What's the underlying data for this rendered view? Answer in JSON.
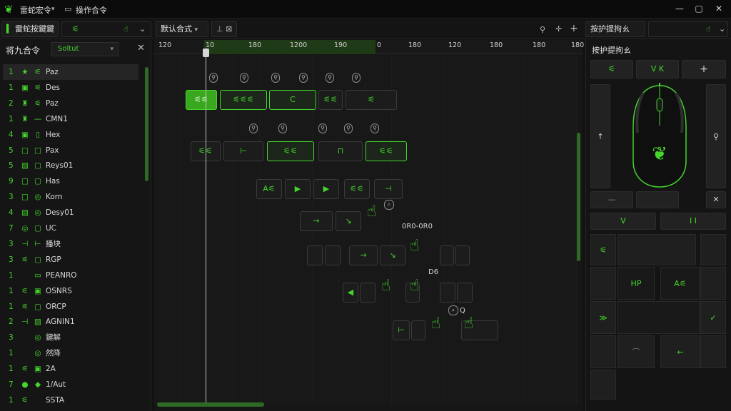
{
  "app": {
    "title_left": "雷蛇宏令",
    "title_doc": "操作合令"
  },
  "toolbar": {
    "profile": "雷蛇按鍵鍵",
    "mode": "默认合式",
    "mode_icon": "▾"
  },
  "commands_panel": {
    "title": "将九合令",
    "filter": "Soltut",
    "items": [
      {
        "num": "1",
        "icon": "★",
        "icon2": "⚟",
        "label": "Paz",
        "active": true
      },
      {
        "num": "1",
        "icon": "▣",
        "icon2": "⚟",
        "label": "Des"
      },
      {
        "num": "2",
        "icon": "♜",
        "icon2": "⚟",
        "label": "Paz"
      },
      {
        "num": "1",
        "icon": "♜",
        "icon2": "—",
        "label": "CMN1"
      },
      {
        "num": "4",
        "icon": "▣",
        "icon2": "▯",
        "label": "Hex"
      },
      {
        "num": "5",
        "icon": "□",
        "icon2": "□",
        "label": "Pax"
      },
      {
        "num": "5",
        "icon": "▧",
        "icon2": "▢",
        "label": "Reys01"
      },
      {
        "num": "9",
        "icon": "□",
        "icon2": "▢",
        "label": "Has"
      },
      {
        "num": "3",
        "icon": "□",
        "icon2": "◎",
        "label": "Korn"
      },
      {
        "num": "4",
        "icon": "▧",
        "icon2": "◎",
        "label": "Desy01"
      },
      {
        "num": "7",
        "icon": "◎",
        "icon2": "▢",
        "label": "UC"
      },
      {
        "num": "3",
        "icon": "⊣",
        "icon2": "⊢",
        "label": "播块"
      },
      {
        "num": "3",
        "icon": "⚟",
        "icon2": "▢",
        "label": "RGP"
      },
      {
        "num": "1",
        "icon": "",
        "icon2": "▭",
        "label": "PEANRO"
      },
      {
        "num": "1",
        "icon": "⚟",
        "icon2": "▣",
        "label": "OSNRS"
      },
      {
        "num": "1",
        "icon": "⚟",
        "icon2": "▢",
        "label": "ORCP"
      },
      {
        "num": "2",
        "icon": "⊣",
        "icon2": "▧",
        "label": "AGNIN1"
      },
      {
        "num": "3",
        "icon": "",
        "icon2": "◎",
        "label": "鍵解"
      },
      {
        "num": "1",
        "icon": "",
        "icon2": "◎",
        "label": "然降"
      },
      {
        "num": "1",
        "icon": "⚟",
        "icon2": "▣",
        "label": "2A"
      },
      {
        "num": "7",
        "icon": "●",
        "icon2": "◆",
        "label": "1/Aut"
      },
      {
        "num": "1",
        "icon": "⚟",
        "icon2": "",
        "label": "SSTA"
      }
    ]
  },
  "timeline": {
    "ticks": [
      "120",
      "10",
      "180",
      "1200",
      "190",
      "0",
      "180",
      "120",
      "180",
      "180",
      "180"
    ],
    "labels": {
      "range": "0R0-0R0",
      "label_a": "D6",
      "label_b": "Q"
    },
    "blocks": {
      "r1": [
        "⚟⚟",
        "⚟⚟⚟",
        "C",
        "",
        "⚟⚟",
        "",
        "⚟",
        ""
      ],
      "r2": [
        "⚟⚟",
        "⊢",
        "⚟⚟",
        "⚟⚟",
        "⊓",
        "",
        "⚟⚟"
      ],
      "r3": [
        "A⚟",
        "▶",
        "▶",
        "⚟⚟",
        "⊣"
      ],
      "r4": [
        "→",
        "↘"
      ],
      "r5": [
        "",
        "",
        "→",
        "↘",
        "",
        ""
      ],
      "r6": [
        "◀",
        "",
        "",
        "",
        ""
      ],
      "r7": [
        "⊢",
        "",
        ""
      ]
    }
  },
  "mapping_panel": {
    "title": "按护提拘ㄠ",
    "top_buttons": [
      "⚟",
      "V  K",
      "+"
    ],
    "side_labels": [
      "↑",
      "⚲"
    ],
    "mid_buttons": [
      "V",
      "I I"
    ],
    "grid_labels": [
      "HP",
      "A⚟",
      "≫",
      "✓",
      "⌒",
      "←"
    ],
    "top_left_icon": "⚟"
  },
  "colors": {
    "accent": "#44d62c",
    "background": "#121212",
    "panel": "#151515"
  }
}
